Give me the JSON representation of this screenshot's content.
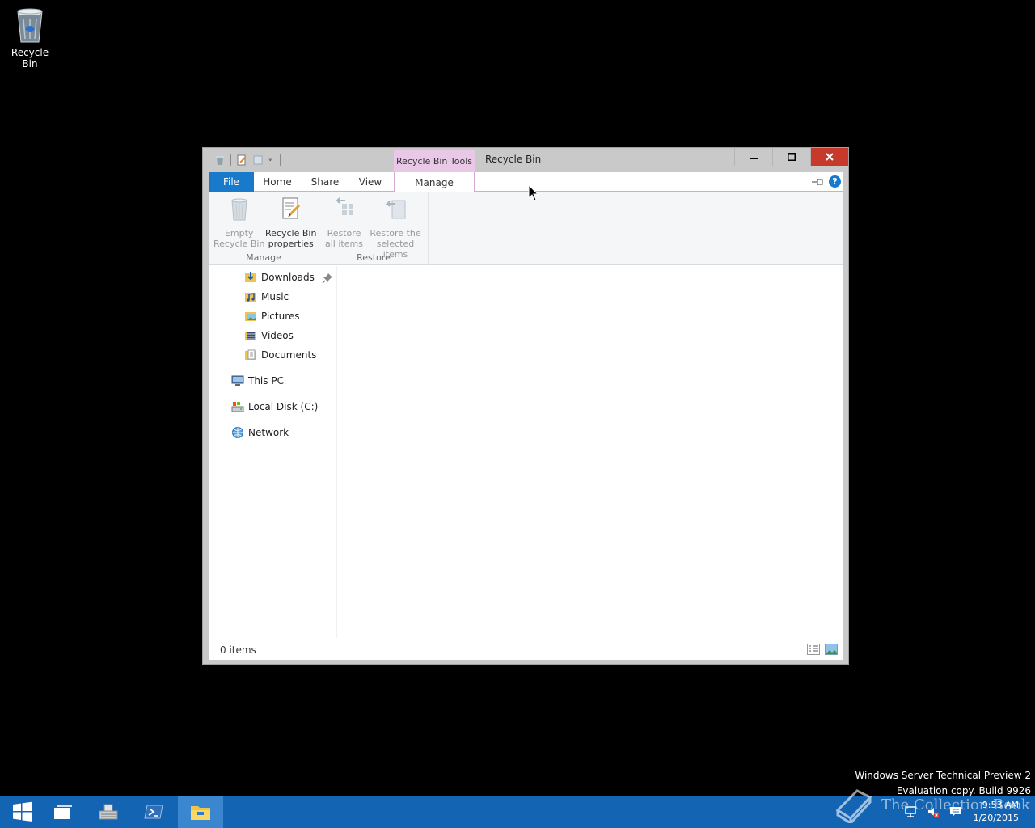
{
  "desktop": {
    "icons": [
      {
        "label": "Recycle Bin",
        "icon": "recycle-bin-icon"
      }
    ]
  },
  "window": {
    "title": "Recycle Bin",
    "context_tab_header": "Recycle Bin Tools",
    "controls": {
      "minimize": "minimize-icon",
      "maximize": "maximize-icon",
      "close": "close-icon"
    }
  },
  "ribbon": {
    "tabs": [
      {
        "label": "File",
        "active": false
      },
      {
        "label": "Home",
        "active": false
      },
      {
        "label": "Share",
        "active": false
      },
      {
        "label": "View",
        "active": false
      },
      {
        "label": "Manage",
        "active": true
      }
    ],
    "groups": [
      {
        "label": "Manage",
        "buttons": [
          {
            "label_line1": "Empty",
            "label_line2": "Recycle Bin",
            "enabled": false,
            "icon": "recycle-bin-icon"
          },
          {
            "label_line1": "Recycle Bin",
            "label_line2": "properties",
            "enabled": true,
            "icon": "properties-icon"
          }
        ]
      },
      {
        "label": "Restore",
        "buttons": [
          {
            "label_line1": "Restore",
            "label_line2": "all items",
            "enabled": false,
            "icon": "restore-all-icon"
          },
          {
            "label_line1": "Restore the",
            "label_line2": "selected items",
            "enabled": false,
            "icon": "restore-selected-icon"
          }
        ]
      }
    ]
  },
  "nav": {
    "quick_access": [
      {
        "label": "Downloads",
        "icon": "downloads-icon"
      },
      {
        "label": "Music",
        "icon": "music-icon"
      },
      {
        "label": "Pictures",
        "icon": "pictures-icon"
      },
      {
        "label": "Videos",
        "icon": "videos-icon"
      },
      {
        "label": "Documents",
        "icon": "documents-icon"
      }
    ],
    "locations": [
      {
        "label": "This PC",
        "icon": "computer-icon"
      },
      {
        "label": "Local Disk (C:)",
        "icon": "disk-icon"
      },
      {
        "label": "Network",
        "icon": "network-icon"
      }
    ]
  },
  "status": {
    "items_count": "0 items"
  },
  "watermark": {
    "line1": "Windows Server Technical Preview 2",
    "line2": "Evaluation copy. Build 9926"
  },
  "overlay": {
    "book_text": "The Collection Book"
  },
  "taskbar": {
    "buttons": [
      {
        "name": "start",
        "icon": "windows-logo-icon"
      },
      {
        "name": "task-view",
        "icon": "task-view-icon"
      },
      {
        "name": "server-manager",
        "icon": "server-manager-icon"
      },
      {
        "name": "powershell",
        "icon": "powershell-icon"
      },
      {
        "name": "file-explorer",
        "icon": "folder-icon",
        "active": true
      }
    ],
    "clock": {
      "time": "9:53 AM",
      "date": "1/20/2015"
    }
  },
  "colors": {
    "file_tab": "#1979ca",
    "context_tab": "#e8c8e6",
    "close_button": "#c7392b",
    "taskbar": "#1464b4"
  }
}
